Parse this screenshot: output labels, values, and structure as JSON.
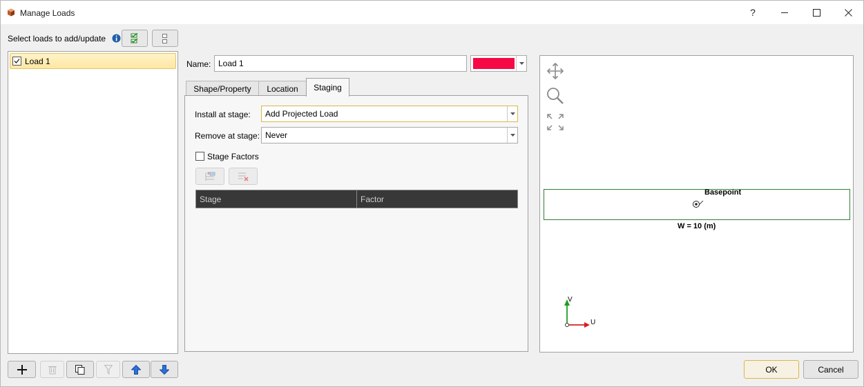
{
  "window": {
    "title": "Manage Loads",
    "help_label": "?",
    "minimize_label": "—",
    "maximize_label": "☐",
    "close_label": "✕"
  },
  "select_loads": {
    "label": "Select loads to add/update"
  },
  "loads_list": {
    "items": [
      {
        "label": "Load 1",
        "checked": true
      }
    ]
  },
  "name": {
    "label": "Name:",
    "value": "Load 1",
    "color": "#f50a46"
  },
  "tabs": [
    {
      "label": "Shape/Property",
      "active": false
    },
    {
      "label": "Location",
      "active": false
    },
    {
      "label": "Staging",
      "active": true
    }
  ],
  "staging": {
    "install_label": "Install at stage:",
    "install_value": "Add Projected Load",
    "remove_label": "Remove at stage:",
    "remove_value": "Never",
    "stage_factors_label": "Stage Factors",
    "stage_factors_checked": false,
    "columns": [
      "Stage",
      "Factor"
    ]
  },
  "viewer": {
    "basepoint_label": "Basepoint",
    "width_label": "W = 10 (m)",
    "axis_v": "V",
    "axis_u": "U"
  },
  "dialog_buttons": {
    "ok": "OK",
    "cancel": "Cancel"
  },
  "colors": {
    "accent_border": "#d8b84a",
    "load_outline": "#2e7d32",
    "blue_button": "#2e6fd8"
  }
}
